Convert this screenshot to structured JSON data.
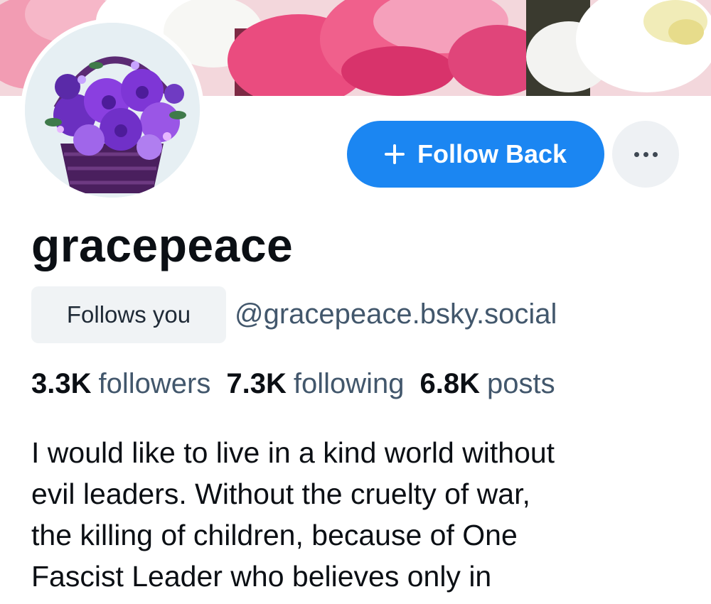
{
  "profile": {
    "display_name": "gracepeace",
    "handle": "@gracepeace.bsky.social",
    "follows_you_label": "Follows you",
    "follow_back_label": "Follow Back",
    "stats": {
      "followers_count": "3.3K",
      "followers_label": "followers",
      "following_count": "7.3K",
      "following_label": "following",
      "posts_count": "6.8K",
      "posts_label": "posts"
    },
    "bio": "I would like to live in a kind world without\nevil leaders. Without the cruelty of war,\nthe killing of children, because of One\nFascist Leader who believes only in"
  },
  "icons": {
    "follow": "plus-icon",
    "more": "ellipsis-icon"
  },
  "colors": {
    "accent": "#1b86f2",
    "muted_text": "#42576c",
    "badge_bg": "#f0f3f5"
  }
}
